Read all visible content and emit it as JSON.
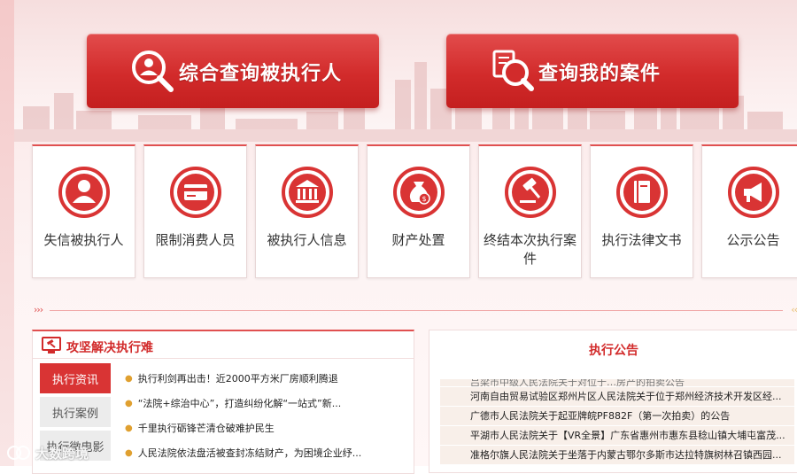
{
  "banner": {
    "search_person_label": "综合查询被执行人",
    "search_case_label": "查询我的案件"
  },
  "categories": [
    {
      "label": "失信被执行人",
      "icon": "person-icon"
    },
    {
      "label": "限制消费人员",
      "icon": "card-icon"
    },
    {
      "label": "被执行人信息",
      "icon": "court-building-icon"
    },
    {
      "label": "财产处置",
      "icon": "money-bag-icon"
    },
    {
      "label": "终结本次执行案件",
      "icon": "gavel-icon"
    },
    {
      "label": "执行法律文书",
      "icon": "law-book-icon"
    },
    {
      "label": "公示公告",
      "icon": "megaphone-icon"
    }
  ],
  "news_panel": {
    "title": "攻坚解决执行难",
    "tabs": [
      "执行资讯",
      "执行案例",
      "执行微电影"
    ],
    "items": [
      "执行利剑再出击！近2000平方米厂房顺利腾退",
      "“法院+综治中心”，打造纠纷化解“一站式”新...",
      "千里执行砺锋芒清仓破难护民生",
      "人民法院依法盘活被查封冻结财产，为困境企业纾..."
    ]
  },
  "notice_panel": {
    "title": "执行公告",
    "items": [
      "吕梁市中级人民法院关于对位于…房产的拍卖公告",
      "河南自由贸易试验区郑州片区人民法院关于位于郑州经济技术开发区经...",
      "广德市人民法院关于起亚牌皖PF882F（第一次拍卖）的公告",
      "平湖市人民法院关于【VR全景】广东省惠州市惠东县稔山镇大埔屯富茂...",
      "准格尔旗人民法院关于坐落于内蒙古鄂尔多斯市达拉特旗树林召镇西园..."
    ]
  },
  "watermark": {
    "text": "大数跨境"
  },
  "colors": {
    "accent": "#d22b2b",
    "tab_active": "#d93434",
    "bullet": "#e0a030"
  }
}
